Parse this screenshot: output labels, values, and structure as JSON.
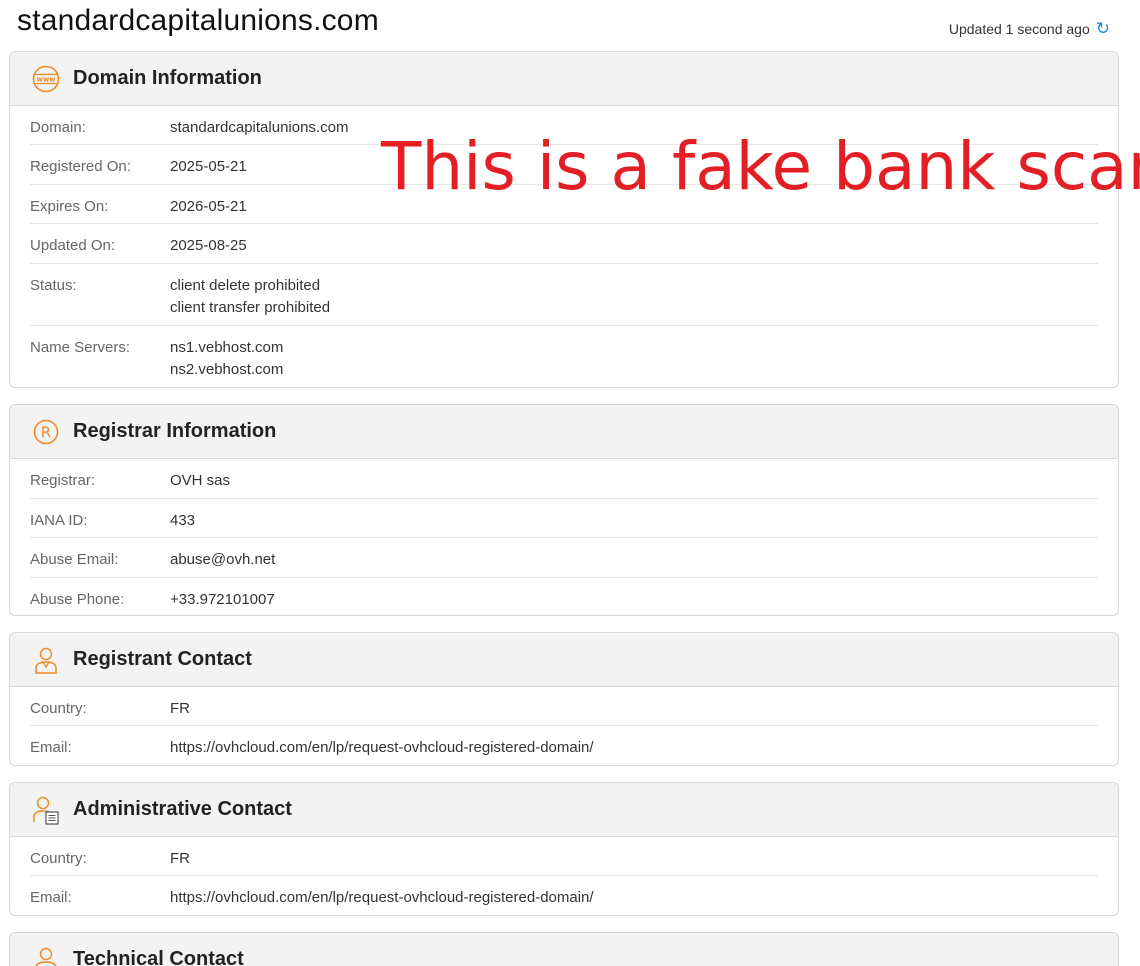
{
  "header": {
    "site_title": "standardcapitalunions.com",
    "updated_text": "Updated 1 second ago",
    "refresh_icon": "refresh-icon"
  },
  "annotation": {
    "text": "This is a fake bank scam",
    "color": "#e31e24"
  },
  "accent_color": "#f08a24",
  "domain_info": {
    "title": "Domain Information",
    "icon": "www-icon",
    "rows": [
      {
        "label": "Domain:",
        "values": [
          "standardcapitalunions.com"
        ]
      },
      {
        "label": "Registered On:",
        "values": [
          "2025-05-21"
        ]
      },
      {
        "label": "Expires On:",
        "values": [
          "2026-05-21"
        ]
      },
      {
        "label": "Updated On:",
        "values": [
          "2025-08-25"
        ]
      },
      {
        "label": "Status:",
        "values": [
          "client delete prohibited",
          "client transfer prohibited"
        ]
      },
      {
        "label": "Name Servers:",
        "values": [
          "ns1.vebhost.com",
          "ns2.vebhost.com"
        ]
      }
    ]
  },
  "registrar_info": {
    "title": "Registrar Information",
    "icon": "registered-icon",
    "rows": [
      {
        "label": "Registrar:",
        "values": [
          "OVH sas"
        ]
      },
      {
        "label": "IANA ID:",
        "values": [
          "433"
        ]
      },
      {
        "label": "Abuse Email:",
        "values": [
          "abuse@ovh.net"
        ]
      },
      {
        "label": "Abuse Phone:",
        "values": [
          "+33.972101007"
        ]
      }
    ]
  },
  "registrant_contact": {
    "title": "Registrant Contact",
    "icon": "person-icon",
    "rows": [
      {
        "label": "Country:",
        "values": [
          "FR"
        ]
      },
      {
        "label": "Email:",
        "values": [
          "https://ovhcloud.com/en/lp/request-ovhcloud-registered-domain/"
        ]
      }
    ]
  },
  "administrative_contact": {
    "title": "Administrative Contact",
    "icon": "admin-person-icon",
    "rows": [
      {
        "label": "Country:",
        "values": [
          "FR"
        ]
      },
      {
        "label": "Email:",
        "values": [
          "https://ovhcloud.com/en/lp/request-ovhcloud-registered-domain/"
        ]
      }
    ]
  },
  "technical_contact": {
    "title": "Technical Contact",
    "icon": "tech-person-icon"
  }
}
